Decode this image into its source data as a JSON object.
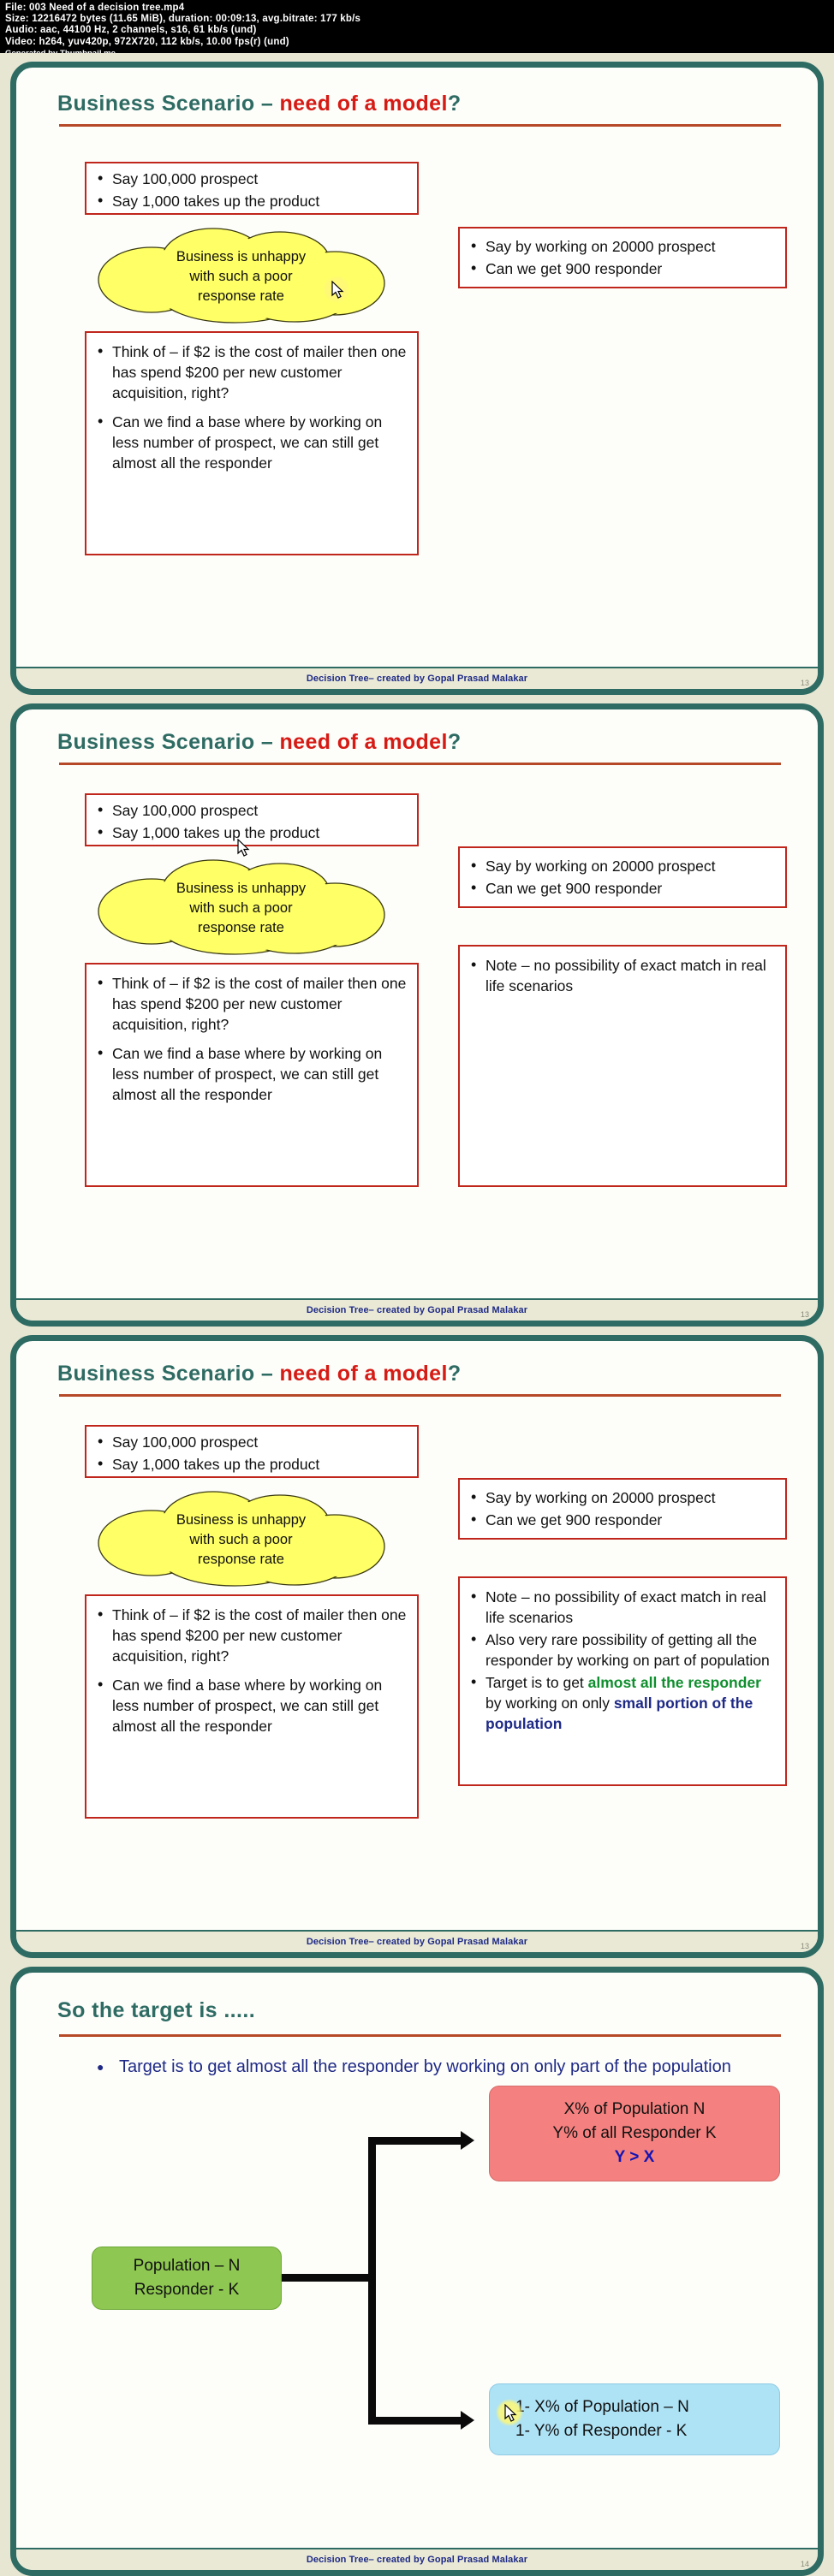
{
  "meta": {
    "file": "File: 003 Need of a decision tree.mp4",
    "size": "Size: 12216472 bytes (11.65 MiB), duration: 00:09:13, avg.bitrate: 177 kb/s",
    "audio": "Audio: aac, 44100 Hz, 2 channels, s16, 61 kb/s (und)",
    "video": "Video: h264, yuv420p, 972X720, 112 kb/s, 10.00 fps(r) (und)",
    "generated": "Generated by Thumbnail me"
  },
  "footer": "Decision Tree– created by Gopal Prasad Malakar",
  "colors": {
    "slide_border": "#2e6b63",
    "title_teal": "#2e6b63",
    "title_red": "#d61a14",
    "rule": "#b64a28",
    "box_border": "#c0261c",
    "cloud_fill": "#ffff66",
    "footer_text": "#1f2a86",
    "green_box": "#8ec751",
    "red_box": "#f4817f",
    "blue_box": "#aee2f5",
    "slide_bg": "#e6e6d2"
  },
  "slides": [
    {
      "id": "slide-1",
      "title_main": "Business Scenario ",
      "title_dash": "– ",
      "title_red": "need of a model",
      "title_end": "?",
      "left_top_box": [
        "Say 100,000 prospect",
        "Say 1,000 takes up the product"
      ],
      "cloud": [
        "Business is unhappy",
        "with such a poor",
        "response rate"
      ],
      "left_bottom_box": [
        "Think of – if $2 is the cost of mailer then one has spend $200 per new customer acquisition, right?",
        "Can we find a base where by working on less number of prospect, we can still get almost all the responder"
      ],
      "right_top_box": [
        "Say by working on 20000 prospect",
        "Can we get 900 responder"
      ],
      "right_bottom_box": [],
      "page": "13"
    },
    {
      "id": "slide-2",
      "title_main": "Business Scenario ",
      "title_dash": "– ",
      "title_red": "need of a model",
      "title_end": "?",
      "left_top_box": [
        "Say 100,000 prospect",
        "Say 1,000 takes up the product"
      ],
      "cloud": [
        "Business is unhappy",
        "with such a poor",
        "response rate"
      ],
      "left_bottom_box": [
        "Think of – if $2 is the cost of mailer then one has spend $200 per new customer acquisition, right?",
        "Can we find a base where by working on less number of prospect, we can still get almost all the responder"
      ],
      "right_top_box": [
        "Say by working on 20000 prospect",
        "Can we get 900 responder"
      ],
      "right_bottom_box": [
        "Note – no possibility of exact match in real life scenarios"
      ],
      "page": "13"
    },
    {
      "id": "slide-3",
      "title_main": "Business Scenario ",
      "title_dash": "– ",
      "title_red": "need of a model",
      "title_end": "?",
      "left_top_box": [
        "Say 100,000 prospect",
        "Say 1,000 takes up the product"
      ],
      "cloud": [
        "Business is unhappy",
        "with such a poor",
        "response rate"
      ],
      "left_bottom_box": [
        "Think of – if $2 is the cost of mailer then one has spend $200 per new customer acquisition, right?",
        "Can we find a base where by working on less number of prospect, we can still get almost all the responder"
      ],
      "right_top_box": [
        "Say by working on 20000 prospect",
        "Can we get 900 responder"
      ],
      "right_bottom_box": [
        "Note – no possibility of exact match in real life scenarios",
        "Also very rare possibility of getting all the responder by working on part of population"
      ],
      "right_bottom_rich": {
        "lead": "Target is to get ",
        "green1": "almost all the responder",
        "mid": " by working on only ",
        "blue1": "small portion of the population"
      },
      "page": "13"
    },
    {
      "id": "slide-4",
      "title_main": "So the target is .....",
      "bullet": "Target is to get almost all the responder by working on only part of the population",
      "diagram": {
        "type": "flow",
        "source": {
          "lines": [
            "Population – N",
            "Responder - K"
          ],
          "color": "#8ec751"
        },
        "branches": [
          {
            "lines": [
              "X% of  Population N",
              "Y% of all Responder K"
            ],
            "emphasis": "Y > X",
            "color": "#f4817f"
          },
          {
            "lines": [
              "1- X% of Population – N",
              "1- Y% of Responder - K"
            ],
            "emphasis": "",
            "color": "#aee2f5"
          }
        ]
      },
      "page": "14"
    }
  ]
}
